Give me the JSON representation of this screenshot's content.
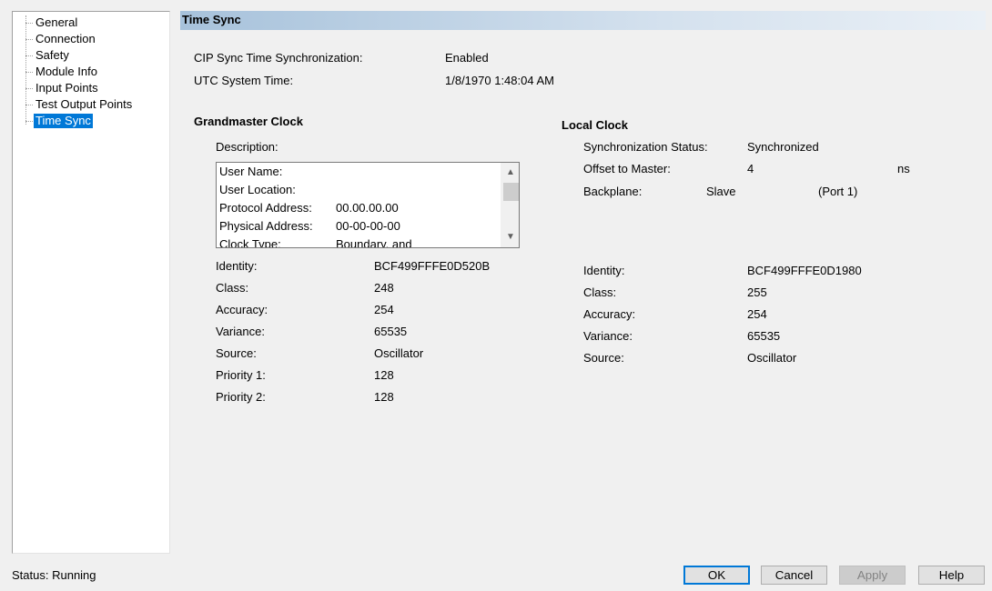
{
  "tree": {
    "items": [
      "General",
      "Connection",
      "Safety",
      "Module Info",
      "Input Points",
      "Test Output Points",
      "Time Sync"
    ],
    "selected": "Time Sync"
  },
  "header": {
    "title": "Time Sync"
  },
  "sync": {
    "cip_label": "CIP Sync Time Synchronization:",
    "cip_value": "Enabled",
    "utc_label": "UTC System Time:",
    "utc_value": "1/8/1970 1:48:04 AM"
  },
  "grandmaster": {
    "title": "Grandmaster Clock",
    "description_label": "Description:",
    "description_rows": [
      {
        "label": "User Name:",
        "value": ""
      },
      {
        "label": "User Location:",
        "value": ""
      },
      {
        "label": "Protocol Address:",
        "value": "00.00.00.00"
      },
      {
        "label": "Physical Address:",
        "value": "00-00-00-00"
      },
      {
        "label": "Clock Type:",
        "value": "Boundary, and"
      }
    ],
    "fields": [
      {
        "label": "Identity:",
        "value": "BCF499FFFE0D520B"
      },
      {
        "label": "Class:",
        "value": "248"
      },
      {
        "label": "Accuracy:",
        "value": "254"
      },
      {
        "label": "Variance:",
        "value": "65535"
      },
      {
        "label": "Source:",
        "value": "Oscillator"
      },
      {
        "label": "Priority 1:",
        "value": "128"
      },
      {
        "label": "Priority 2:",
        "value": "128"
      }
    ]
  },
  "local": {
    "title": "Local Clock",
    "sync_status_label": "Synchronization Status:",
    "sync_status_value": "Synchronized",
    "offset_label": "Offset to Master:",
    "offset_value": "4",
    "offset_unit": "ns",
    "backplane_label": "Backplane:",
    "backplane_value": "Slave",
    "backplane_port": "(Port 1)",
    "fields": [
      {
        "label": "Identity:",
        "value": "BCF499FFFE0D1980"
      },
      {
        "label": "Class:",
        "value": "255"
      },
      {
        "label": "Accuracy:",
        "value": "254"
      },
      {
        "label": "Variance:",
        "value": "65535"
      },
      {
        "label": "Source:",
        "value": "Oscillator"
      }
    ]
  },
  "status": {
    "label": "Status:",
    "value": "Running"
  },
  "buttons": {
    "ok": "OK",
    "cancel": "Cancel",
    "apply": "Apply",
    "help": "Help"
  },
  "colors": {
    "selection": "#0078d7",
    "header_gradient_start": "#a7c2db"
  },
  "icons": {
    "scroll_up": "▲",
    "scroll_down": "▼"
  }
}
